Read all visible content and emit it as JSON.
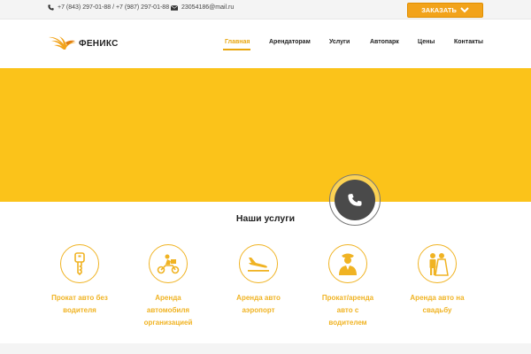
{
  "topbar": {
    "phone": "+7 (843) 297-01-88 / +7 (987) 297-01-88",
    "email": "23054186@mail.ru",
    "order_label": "ЗАКАЗАТЬ"
  },
  "brand": {
    "name": "ФЕНИКС",
    "accent": "#fbc31a",
    "accent_text": "#f0b323"
  },
  "nav": [
    {
      "label": "Главная",
      "active": true
    },
    {
      "label": "Арендаторам"
    },
    {
      "label": "Услуги"
    },
    {
      "label": "Автопарк"
    },
    {
      "label": "Цены"
    },
    {
      "label": "Контакты"
    }
  ],
  "services": {
    "title": "Наши услуги",
    "items": [
      {
        "icon": "key-icon",
        "line1": "Прокат авто без",
        "line2": "водителя",
        "line3": ""
      },
      {
        "icon": "scooter-icon",
        "line1": "Аренда",
        "line2": "автомобиля",
        "line3": "организацией"
      },
      {
        "icon": "plane-landing-icon",
        "line1": "Аренда авто",
        "line2": "аэропорт",
        "line3": ""
      },
      {
        "icon": "chauffeur-icon",
        "line1": "Прокат/аренда",
        "line2": "авто с",
        "line3": "водителем"
      },
      {
        "icon": "wedding-couple-icon",
        "line1": "Аренда авто на",
        "line2": "свадьбу",
        "line3": ""
      }
    ]
  }
}
